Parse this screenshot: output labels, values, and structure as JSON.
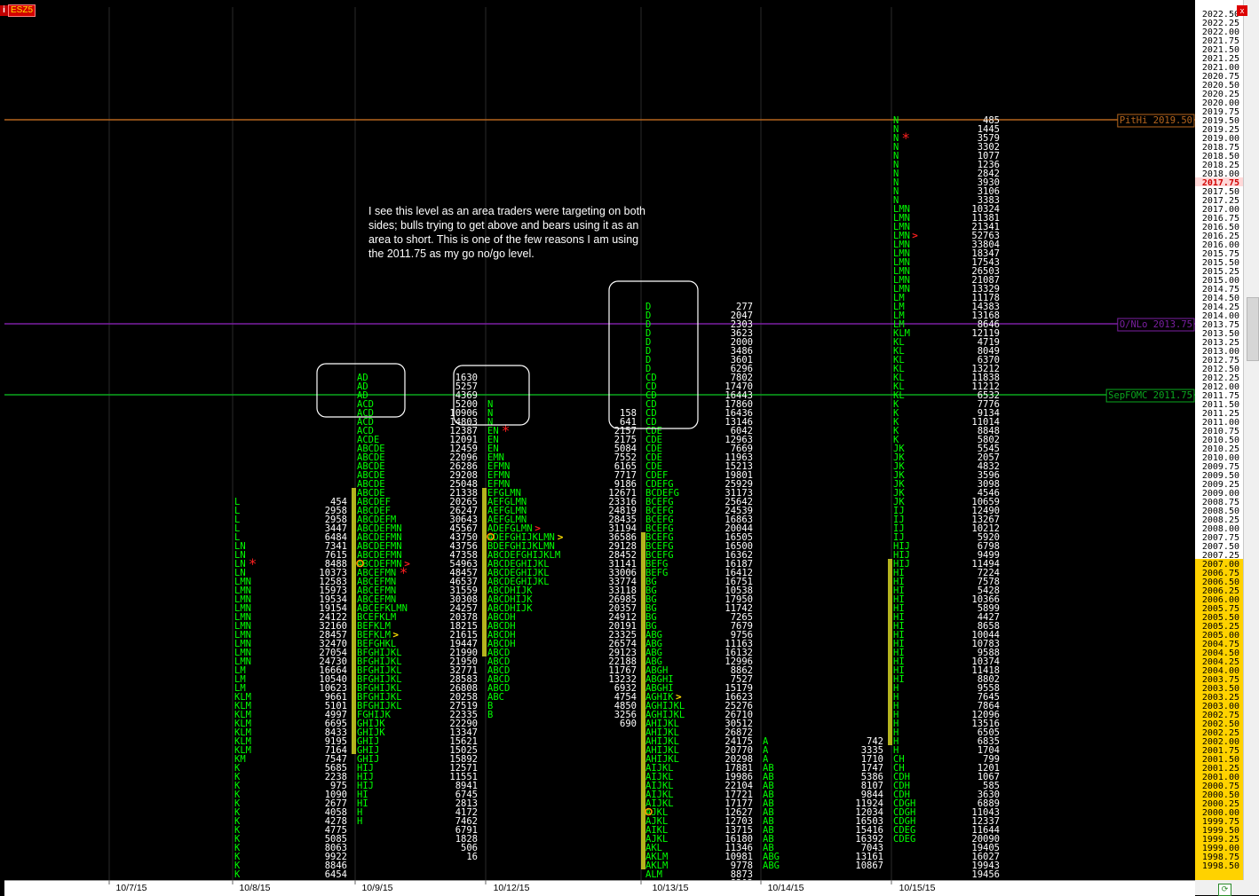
{
  "symbol": "ESZ5",
  "info_badge": "i",
  "annotation": "I see this level as an area traders were targeting on both sides; bulls trying to get above and bears using it as an area to short. This is one of the few reasons I am using the 2011.75 as my go no/go level.",
  "colors": {
    "letters": "#00ff00",
    "volume": "#ffffff",
    "va_bar": "#b4b41e",
    "pithi": "#b5651d",
    "onlo": "#7b1fa2",
    "fomc": "#0aa81e",
    "marker": "#ff2020",
    "highlight": "#ffe000"
  },
  "chart_data": {
    "type": "market-profile",
    "price_axis": {
      "min": 1998.5,
      "max": 2022.5,
      "step": 0.25,
      "current": 2017.75,
      "value_area_from": 1998.5,
      "value_area_to": 2007.0
    },
    "dates": [
      "10/7/15",
      "10/8/15",
      "10/9/15",
      "10/12/15",
      "10/13/15",
      "10/14/15",
      "10/15/15"
    ],
    "levels": [
      {
        "label": "PitHi 2019.50",
        "price": 2019.5
      },
      {
        "label": "O/NLo 2013.75",
        "price": 2013.75
      },
      {
        "label": "SepFOMC 2011.75",
        "price": 2011.75
      }
    ],
    "profiles": [
      {
        "date": "10/8/15",
        "top": 2008.75,
        "letters": [
          "L",
          "L",
          "L",
          "L",
          "L",
          "LN",
          "LN",
          "LN",
          "LN",
          "LMN",
          "LMN",
          "LMN",
          "LMN",
          "LMN",
          "LMN",
          "LMN",
          "LMN",
          "LMN",
          "LMN",
          "LM",
          "LM",
          "LM",
          "KLM",
          "KLM",
          "KLM",
          "KLM",
          "KLM",
          "KLM",
          "KLM",
          "KM",
          "K",
          "K",
          "K",
          "K",
          "K",
          "K",
          "K",
          "K",
          "K",
          "K",
          "K",
          "K",
          "K"
        ],
        "volume_top": 2008.75,
        "volumes": [
          "454",
          "2958",
          "2958",
          "3447",
          "6484",
          "7341",
          "7615",
          "8488",
          "10373",
          "12583",
          "15973",
          "19534",
          "19154",
          "24122",
          "32160",
          "28457",
          "32470",
          "27054",
          "24730",
          "16664",
          "10540",
          "10623",
          "9661",
          "5101",
          "4997",
          "6695",
          "8433",
          "9195",
          "7164",
          "7547",
          "5685",
          "2238",
          "975",
          "1090",
          "2677",
          "4058",
          "4278",
          "4775",
          "5085",
          "8063",
          "9922",
          "8846",
          "6454"
        ]
      },
      {
        "date": "10/9/15",
        "top": 2012.25,
        "letters": [
          "AD",
          "AD",
          "AD",
          "ACD",
          "ACD",
          "ACD",
          "ACD",
          "ACDE",
          "ABCDE",
          "ABCDE",
          "ABCDE",
          "ABCDE",
          "ABCDE",
          "ABCDE",
          "ABCDEF",
          "ABCDEF",
          "ABCDEFM",
          "ABCDEFMN",
          "ABCDEFMN",
          "ABCDEFMN",
          "ABCDEFMN",
          "ABCDEFMN",
          "ABCEFMN",
          "ABCEFMN",
          "ABCEFMN",
          "ABCEFMN",
          "ABCEFKLMN",
          "BCEFKLM",
          "BEFKLM",
          "BEFKLM",
          "BEFGHKL",
          "BFGHIJKL",
          "BFGHIJKL",
          "BFGHIJKL",
          "BFGHIJKL",
          "BFGHIJKL",
          "BFGHIJKL",
          "BFGHIJKL",
          "FGHIJK",
          "GHIJK",
          "GHIJK",
          "GHIJ",
          "GHIJ",
          "GHIJ",
          "HIJ",
          "HIJ",
          "HIJ",
          "HI",
          "HI",
          "H",
          "H"
        ],
        "va": [
          2009.0,
          2001.75
        ]
      },
      {
        "date": "10/12/15",
        "top": 2011.5,
        "letters": [
          "N",
          "N",
          "N",
          "EN",
          "EN",
          "EN",
          "EMN",
          "EFMN",
          "EFMN",
          "EFMN",
          "EFGLMN",
          "AEFGLMN",
          "AEFGLMN",
          "AEFGLMN",
          "ADEFGLMN",
          "ADEFGHIJKLMN",
          "BDEFGHIJKLMN",
          "ABCDEFGHIJKLM",
          "ABCDEGHIJKL",
          "ABCDEGHIJKL",
          "ABCDEGHIJKL",
          "ABCDHIJK",
          "ABCDHIJK",
          "ABCDHIJK",
          "ABCDH",
          "ABCDH",
          "ABCDH",
          "ABCDH",
          "ABCD",
          "ABCD",
          "ABCD",
          "ABCD",
          "ABCD",
          "ABC",
          "B",
          "B"
        ],
        "volume_top": 2012.25,
        "volumes": [
          "1630",
          "5257",
          "4369",
          "5200",
          "10906",
          "14803",
          "12387",
          "12091",
          "12459",
          "22096",
          "26286",
          "29208",
          "25048",
          "21338",
          "20265",
          "26247",
          "30643",
          "45567",
          "43750",
          "43756",
          "47358",
          "54963",
          "48457",
          "46537",
          "31559",
          "30308",
          "24257",
          "20378",
          "18215",
          "21615",
          "19447",
          "21990",
          "21950",
          "32771",
          "28583",
          "26808",
          "20258",
          "27519",
          "22335",
          "22290",
          "13347",
          "15621",
          "15025",
          "15892",
          "12571",
          "11551",
          "8941",
          "6745",
          "2813",
          "4172",
          "7462",
          "6791",
          "1828",
          "506",
          "16"
        ],
        "va": [
          2009.0,
          2004.5
        ]
      },
      {
        "date": "10/13/15",
        "top": 2014.25,
        "letters": [
          "D",
          "D",
          "D",
          "D",
          "D",
          "D",
          "D",
          "D",
          "CD",
          "CD",
          "CD",
          "CD",
          "CD",
          "CD",
          "CDE",
          "CDE",
          "CDE",
          "CDE",
          "CDE",
          "CDEF",
          "CDEFG",
          "BCDEFG",
          "BCEFG",
          "BCEFG",
          "BCEFG",
          "BCEFG",
          "BCEFG",
          "BCEFG",
          "BCEFG",
          "BEFG",
          "BEFG",
          "BG",
          "BG",
          "BG",
          "BG",
          "BG",
          "BG",
          "ABG",
          "ABG",
          "ABG",
          "ABG",
          "ABGH",
          "ABGHI",
          "ABGHI",
          "AGHIK",
          "AGHIJKL",
          "AGHIJKL",
          "AHIJKL",
          "AHIJKL",
          "AHIJKL",
          "AHIJKL",
          "AHIJKL",
          "AIJKL",
          "AIJKL",
          "AIJKL",
          "AIJKL",
          "AIJKL",
          "AJKL",
          "AJKL",
          "AIKL",
          "AJKL",
          "AKL",
          "AKLM",
          "AKLM",
          "ALM"
        ],
        "volumes_left_top": 2011.25,
        "volumes_left": [
          "158",
          "641",
          "2157",
          "2175",
          "5084",
          "7552",
          "6165",
          "7717",
          "9186",
          "12671",
          "23316",
          "24819",
          "28435",
          "31194",
          "36586",
          "29128",
          "28452",
          "31141",
          "33006",
          "33774",
          "33118",
          "26985",
          "20357",
          "24912",
          "20191",
          "23325",
          "26574",
          "29123",
          "22188",
          "11767",
          "13232",
          "6932",
          "4754",
          "4850",
          "3256",
          "690"
        ],
        "volume_top": 2014.25,
        "volumes": [
          "277",
          "2047",
          "2303",
          "3623",
          "2000",
          "3486",
          "3601",
          "6296",
          "7802",
          "17470",
          "16443",
          "17860",
          "16436",
          "13146",
          "6042",
          "12963",
          "7669",
          "11963",
          "15213",
          "19801",
          "25929",
          "31173",
          "25642",
          "24539",
          "16863",
          "20044",
          "16505",
          "16500",
          "16362",
          "16187",
          "16412",
          "16751",
          "10538",
          "17950",
          "11742",
          "7265",
          "7679",
          "9756",
          "11163",
          "16132",
          "12996",
          "8862",
          "7527",
          "15179",
          "16623",
          "25276",
          "26710",
          "30512",
          "26872",
          "24175",
          "20770",
          "20298",
          "17881",
          "19986",
          "22104",
          "17721",
          "17177",
          "12627",
          "12703",
          "13715",
          "16180",
          "11346",
          "10981",
          "9778",
          "8873",
          "8203"
        ],
        "va": [
          2007.75,
          1998.5
        ]
      },
      {
        "date": "10/14/15",
        "top": 2002.0,
        "letters": [
          "A",
          "A",
          "A",
          "AB",
          "AB",
          "AB",
          "AB",
          "AB",
          "AB",
          "AB",
          "AB",
          "AB",
          "AB",
          "ABG",
          "ABG"
        ]
      },
      {
        "date": "10/15/15",
        "top": 2019.5,
        "letters": [
          "N",
          "N",
          "N",
          "N",
          "N",
          "N",
          "N",
          "N",
          "N",
          "N",
          "LMN",
          "LMN",
          "LMN",
          "LMN",
          "LMN",
          "LMN",
          "LMN",
          "LMN",
          "LMN",
          "LMN",
          "LM",
          "LM",
          "LM",
          "LM",
          "KLM",
          "KL",
          "KL",
          "KL",
          "KL",
          "KL",
          "KL",
          "KL",
          "K",
          "K",
          "K",
          "K",
          "K",
          "JK",
          "JK",
          "JK",
          "JK",
          "JK",
          "JK",
          "JK",
          "IJ",
          "IJ",
          "IJ",
          "IJ",
          "HIJ",
          "HIJ",
          "HIJ",
          "HI",
          "HI",
          "HI",
          "HI",
          "HI",
          "HI",
          "HI",
          "HI",
          "HI",
          "HI",
          "HI",
          "HI",
          "HI",
          "H",
          "H",
          "H",
          "H",
          "H",
          "H",
          "H",
          "H",
          "CH",
          "CH",
          "CDH",
          "CDH",
          "CDH",
          "CDGH",
          "CDGH",
          "CDGH",
          "CDEG",
          "CDEG"
        ],
        "volumes_left_top": 2002.0,
        "volumes_left": [
          "742",
          "3335",
          "1710",
          "1747",
          "5386",
          "8107",
          "9844",
          "11924",
          "12034",
          "16503",
          "15416",
          "16392",
          "7043",
          "13161",
          "10867"
        ],
        "volume_top": 2019.5,
        "volumes": [
          "485",
          "1445",
          "3579",
          "3302",
          "1077",
          "1236",
          "2842",
          "3930",
          "3106",
          "3383",
          "10324",
          "11381",
          "21341",
          "52763",
          "33804",
          "18347",
          "17543",
          "26503",
          "21087",
          "13329",
          "11178",
          "14383",
          "13168",
          "8646",
          "12119",
          "4719",
          "8049",
          "6370",
          "13212",
          "11838",
          "11212",
          "6532",
          "7776",
          "9134",
          "11014",
          "8848",
          "5802",
          "5545",
          "2057",
          "4832",
          "3596",
          "3098",
          "4546",
          "10659",
          "12490",
          "13267",
          "10212",
          "5920",
          "6798",
          "9499",
          "11494",
          "7224",
          "7578",
          "5428",
          "10366",
          "5899",
          "4427",
          "8658",
          "10044",
          "10783",
          "9588",
          "10374",
          "11418",
          "8802",
          "9558",
          "7645",
          "7864",
          "12096",
          "13516",
          "6505",
          "6835",
          "1704",
          "799",
          "1201",
          "1067",
          "585",
          "3630",
          "6889",
          "11043",
          "12337",
          "11644",
          "20090",
          "19405",
          "16027",
          "19943",
          "19456"
        ],
        "va": [
          2007.0,
          2002.0
        ]
      }
    ],
    "markers": [
      {
        "date": "10/8/15",
        "price": 2007.0,
        "type": "star"
      },
      {
        "date": "10/9/15",
        "price": 2007.0,
        "type": "open",
        "symbol": "O"
      },
      {
        "date": "10/9/15",
        "price": 2006.75,
        "type": "star"
      },
      {
        "date": "10/9/15",
        "price": 2005.0,
        "type": "close"
      },
      {
        "date": "10/9/15",
        "price": 2007.0,
        "type": "close-red"
      },
      {
        "date": "10/12/15",
        "price": 2010.75,
        "type": "star"
      },
      {
        "date": "10/12/15",
        "price": 2007.75,
        "type": "open",
        "symbol": "O"
      },
      {
        "date": "10/12/15",
        "price": 2007.75,
        "type": "close"
      },
      {
        "date": "10/12/15",
        "price": 2008.0,
        "type": "close-red"
      },
      {
        "date": "10/13/15",
        "price": 2000.0,
        "type": "open",
        "symbol": "O"
      },
      {
        "date": "10/13/15",
        "price": 2003.25,
        "type": "close"
      },
      {
        "date": "10/15/15",
        "price": 2019.0,
        "type": "star"
      },
      {
        "date": "10/15/15",
        "price": 2016.25,
        "type": "close-red"
      }
    ]
  }
}
